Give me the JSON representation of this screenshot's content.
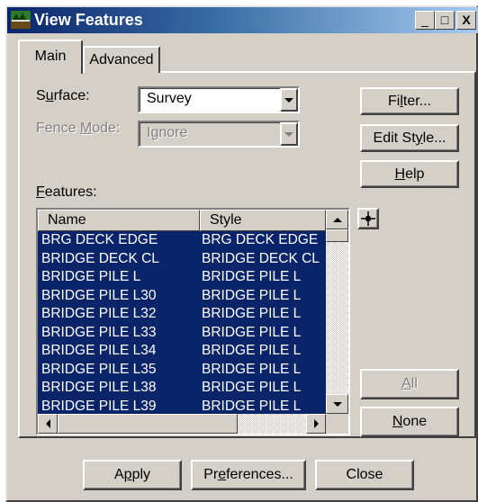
{
  "window": {
    "title": "View Features",
    "icon": "bridge-app-icon",
    "caption_buttons": {
      "minimize": "_",
      "maximize": "□",
      "close": "X"
    }
  },
  "tabs": [
    {
      "label": "Main",
      "selected": true
    },
    {
      "label": "Advanced",
      "selected": false
    }
  ],
  "surface": {
    "label_prefix": "S",
    "label_accel": "u",
    "label_suffix": "rface:",
    "value": "Survey"
  },
  "fence_mode": {
    "label_prefix": "Fence ",
    "label_accel": "M",
    "label_suffix": "ode:",
    "value": "Ignore",
    "enabled": false
  },
  "buttons": {
    "filter": {
      "prefix": "Fi",
      "accel": "l",
      "suffix": "ter..."
    },
    "edit_style": {
      "prefix": "Edit St",
      "accel": "y",
      "suffix": "le..."
    },
    "help": {
      "prefix": "",
      "accel": "H",
      "suffix": "elp"
    },
    "all": {
      "prefix": "",
      "accel": "A",
      "suffix": "ll",
      "enabled": false
    },
    "none": {
      "prefix": "",
      "accel": "N",
      "suffix": "one"
    },
    "apply": {
      "prefix": "A",
      "accel": "p",
      "suffix": "ply"
    },
    "preferences": {
      "prefix": "Pr",
      "accel": "e",
      "suffix": "ferences..."
    },
    "close": {
      "label": "Close"
    }
  },
  "features": {
    "label_accel": "F",
    "label_suffix": "eatures:",
    "columns": [
      "Name",
      "Style"
    ],
    "rows": [
      {
        "name": "BRG DECK EDGE",
        "style": "BRG DECK EDGE"
      },
      {
        "name": "BRIDGE DECK CL",
        "style": "BRIDGE DECK CL"
      },
      {
        "name": "BRIDGE PILE L",
        "style": "BRIDGE PILE L"
      },
      {
        "name": "BRIDGE PILE L30",
        "style": "BRIDGE PILE L"
      },
      {
        "name": "BRIDGE PILE L32",
        "style": "BRIDGE PILE L"
      },
      {
        "name": "BRIDGE PILE L33",
        "style": "BRIDGE PILE L"
      },
      {
        "name": "BRIDGE PILE L34",
        "style": "BRIDGE PILE L"
      },
      {
        "name": "BRIDGE PILE L35",
        "style": "BRIDGE PILE L"
      },
      {
        "name": "BRIDGE PILE L38",
        "style": "BRIDGE PILE L"
      },
      {
        "name": "BRIDGE PILE L39",
        "style": "BRIDGE PILE L"
      }
    ]
  },
  "locate_icon": "crosshair-locate-icon",
  "colors": {
    "face": "#d4d0c8",
    "selection": "#0a246a",
    "titlebar_start": "#0a246a",
    "titlebar_end": "#a6caf0"
  }
}
